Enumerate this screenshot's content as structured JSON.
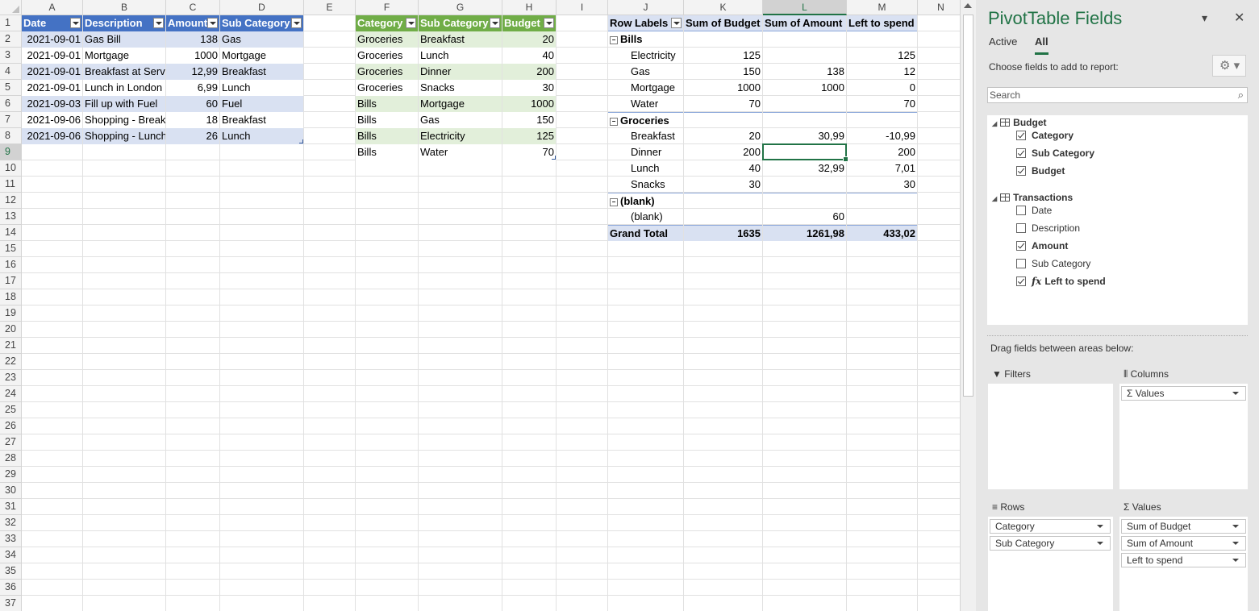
{
  "columns": [
    {
      "letter": "A",
      "w": 76
    },
    {
      "letter": "B",
      "w": 103
    },
    {
      "letter": "C",
      "w": 67
    },
    {
      "letter": "D",
      "w": 104
    },
    {
      "letter": "E",
      "w": 64
    },
    {
      "letter": "F",
      "w": 78
    },
    {
      "letter": "G",
      "w": 104
    },
    {
      "letter": "H",
      "w": 67
    },
    {
      "letter": "I",
      "w": 64
    },
    {
      "letter": "J",
      "w": 94
    },
    {
      "letter": "K",
      "w": 98
    },
    {
      "letter": "L",
      "w": 104
    },
    {
      "letter": "M",
      "w": 88
    },
    {
      "letter": "N",
      "w": 58
    }
  ],
  "row_count": 37,
  "selected_column": "L",
  "selected_row": 9,
  "transactions": {
    "headers": [
      "Date",
      "Description",
      "Amount",
      "Sub Category"
    ],
    "rows": [
      [
        "2021-09-01",
        "Gas Bill",
        "138",
        "Gas"
      ],
      [
        "2021-09-01",
        "Mortgage",
        "1000",
        "Mortgage"
      ],
      [
        "2021-09-01",
        "Breakfast at Serv",
        "12,99",
        "Breakfast"
      ],
      [
        "2021-09-01",
        "Lunch in London",
        "6,99",
        "Lunch"
      ],
      [
        "2021-09-03",
        "Fill up with Fuel",
        "60",
        "Fuel"
      ],
      [
        "2021-09-06",
        "Shopping - Break",
        "18",
        "Breakfast"
      ],
      [
        "2021-09-06",
        "Shopping - Lunch",
        "26",
        "Lunch"
      ]
    ]
  },
  "budget": {
    "headers": [
      "Category",
      "Sub Category",
      "Budget"
    ],
    "rows": [
      [
        "Groceries",
        "Breakfast",
        "20"
      ],
      [
        "Groceries",
        "Lunch",
        "40"
      ],
      [
        "Groceries",
        "Dinner",
        "200"
      ],
      [
        "Groceries",
        "Snacks",
        "30"
      ],
      [
        "Bills",
        "Mortgage",
        "1000"
      ],
      [
        "Bills",
        "Gas",
        "150"
      ],
      [
        "Bills",
        "Electricity",
        "125"
      ],
      [
        "Bills",
        "Water",
        "70"
      ]
    ]
  },
  "pivot": {
    "headers": [
      "Row Labels",
      "Sum of Budget",
      "Sum of Amount",
      "Left to spend"
    ],
    "rows": [
      {
        "label": "Bills",
        "group": true,
        "vals": [
          "",
          "",
          ""
        ]
      },
      {
        "label": "Electricity",
        "vals": [
          "125",
          "",
          "125"
        ]
      },
      {
        "label": "Gas",
        "vals": [
          "150",
          "138",
          "12"
        ]
      },
      {
        "label": "Mortgage",
        "vals": [
          "1000",
          "1000",
          "0"
        ]
      },
      {
        "label": "Water",
        "vals": [
          "70",
          "",
          "70"
        ]
      },
      {
        "label": "Groceries",
        "group": true,
        "vals": [
          "",
          "",
          ""
        ]
      },
      {
        "label": "Breakfast",
        "vals": [
          "20",
          "30,99",
          "-10,99"
        ]
      },
      {
        "label": "Dinner",
        "vals": [
          "200",
          "",
          "200"
        ]
      },
      {
        "label": "Lunch",
        "vals": [
          "40",
          "32,99",
          "7,01"
        ]
      },
      {
        "label": "Snacks",
        "vals": [
          "30",
          "",
          "30"
        ]
      },
      {
        "label": "(blank)",
        "group": true,
        "vals": [
          "",
          "",
          ""
        ]
      },
      {
        "label": "(blank)",
        "vals": [
          "",
          "60",
          ""
        ]
      }
    ],
    "grand_total": {
      "label": "Grand Total",
      "vals": [
        "1635",
        "1261,98",
        "433,02"
      ]
    }
  },
  "pane": {
    "title": "PivotTable Fields",
    "tab_active": "Active",
    "tab_all": "All",
    "choose": "Choose fields to add to report:",
    "search_placeholder": "Search",
    "table1": "Budget",
    "table1_fields": [
      {
        "name": "Category",
        "checked": true
      },
      {
        "name": "Sub Category",
        "checked": true
      },
      {
        "name": "Budget",
        "checked": true
      }
    ],
    "table2": "Transactions",
    "table2_fields": [
      {
        "name": "Date",
        "checked": false
      },
      {
        "name": "Description",
        "checked": false
      },
      {
        "name": "Amount",
        "checked": true
      },
      {
        "name": "Sub Category",
        "checked": false
      },
      {
        "name": "Left to spend",
        "checked": true,
        "calc": true
      }
    ],
    "drag": "Drag fields between areas below:",
    "filters": "Filters",
    "columns": "Columns",
    "rows": "Rows",
    "values": "Values",
    "columns_items": [
      "Σ Values"
    ],
    "rows_items": [
      "Category",
      "Sub Category"
    ],
    "values_items": [
      "Sum of Budget",
      "Sum of Amount",
      "Left to spend"
    ]
  },
  "colors": {
    "accent": "#217346",
    "table_blue_header": "#4472c4",
    "table_blue_band": "#d9e1f2",
    "table_green_header": "#70ad47",
    "table_green_band": "#e2efda",
    "pivot_header": "#d9e1f2"
  }
}
